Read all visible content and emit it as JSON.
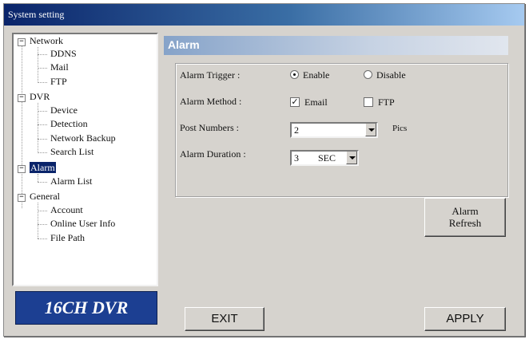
{
  "window": {
    "title": "System setting"
  },
  "tree": {
    "network": {
      "label": "Network",
      "toggle": "−",
      "children": [
        "DDNS",
        "Mail",
        "FTP"
      ]
    },
    "dvr": {
      "label": "DVR",
      "toggle": "−",
      "children": [
        "Device",
        "Detection",
        "Network Backup",
        "Search List"
      ]
    },
    "alarm": {
      "label": "Alarm",
      "toggle": "−",
      "children": [
        "Alarm List"
      ]
    },
    "general": {
      "label": "General",
      "toggle": "−",
      "children": [
        "Account",
        "Online User Info",
        "File Path"
      ]
    }
  },
  "logo": {
    "text": "16CH DVR"
  },
  "panel": {
    "title": "Alarm",
    "trigger": {
      "label": "Alarm Trigger :",
      "enable": "Enable",
      "disable": "Disable",
      "selected": "Enable"
    },
    "method": {
      "label": "Alarm Method :",
      "email": "Email",
      "ftp": "FTP",
      "email_checked": "✓"
    },
    "post_numbers": {
      "label": "Post Numbers :",
      "value": "2",
      "unit": "Pics"
    },
    "duration": {
      "label": "Alarm Duration :",
      "value": "3",
      "unit": "SEC"
    }
  },
  "buttons": {
    "alarm_refresh_line1": "Alarm",
    "alarm_refresh_line2": "Refresh",
    "exit": "EXIT",
    "apply": "APPLY"
  },
  "colors": {
    "title_bar": "#0a246a",
    "selection": "#0a246a",
    "logo_bg": "#1c3f92",
    "window_bg": "#d6d3ce"
  }
}
